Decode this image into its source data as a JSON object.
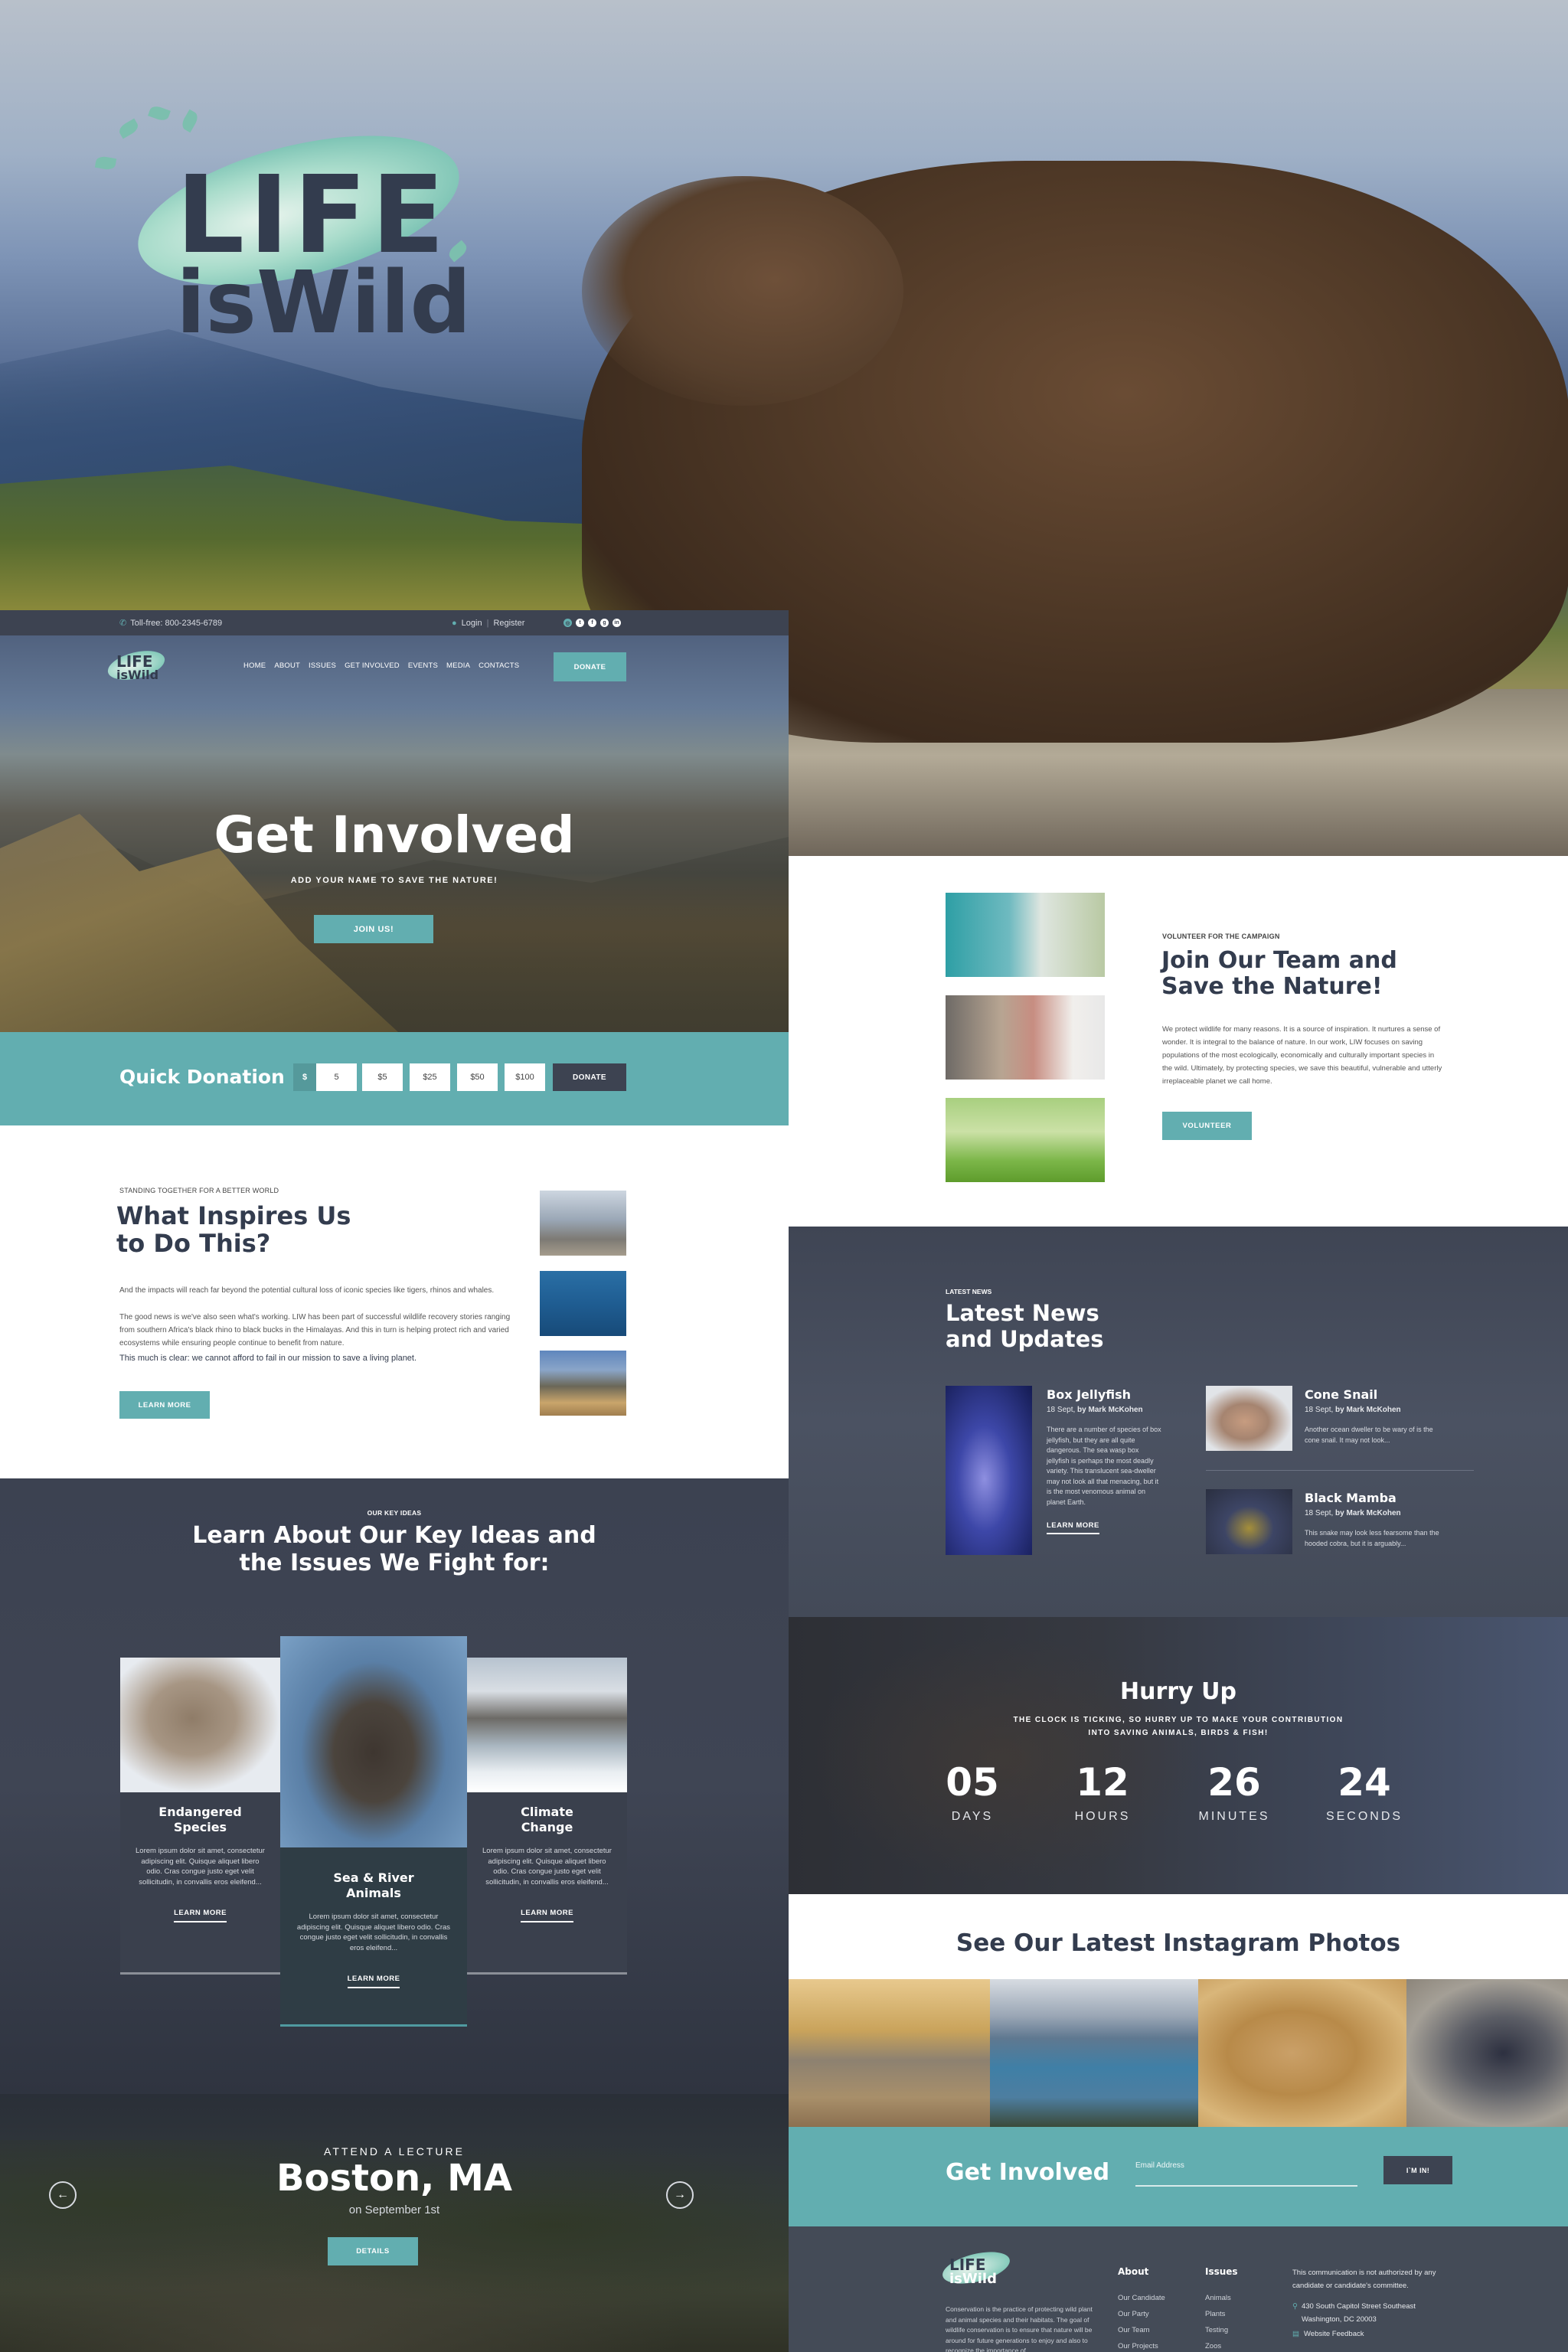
{
  "brand": {
    "line1": "LIFE",
    "line2": "isWild"
  },
  "colors": {
    "accent": "#62aeb0",
    "dark": "#3d4351",
    "heading": "#333c4e"
  },
  "topbar": {
    "phone_icon": "phone-icon",
    "phone": "Toll-free: 800-2345-6789",
    "user_icon": "user-icon",
    "login": "Login",
    "separator": "|",
    "register": "Register",
    "social": [
      {
        "icon": "instagram-icon",
        "glyph": "◎"
      },
      {
        "icon": "twitter-icon",
        "glyph": "t"
      },
      {
        "icon": "facebook-icon",
        "glyph": "f"
      },
      {
        "icon": "google-plus-icon",
        "glyph": "g"
      },
      {
        "icon": "linkedin-icon",
        "glyph": "in"
      }
    ]
  },
  "nav": {
    "items": [
      "HOME",
      "ABOUT",
      "ISSUES",
      "GET INVOLVED",
      "EVENTS",
      "MEDIA",
      "CONTACTS"
    ],
    "donate": "DONATE"
  },
  "hero": {
    "title": "Get Involved",
    "subtitle": "ADD YOUR NAME TO SAVE THE NATURE!",
    "button": "JOIN US!"
  },
  "quick_donation": {
    "label": "Quick Donation",
    "currency": "$",
    "amount_value": "5",
    "presets": [
      "$5",
      "$25",
      "$50",
      "$100"
    ],
    "button": "DONATE"
  },
  "inspire": {
    "kicker": "STANDING TOGETHER FOR A BETTER WORLD",
    "title_line1": "What Inspires Us",
    "title_line2": "to Do This?",
    "p1": "And the impacts will reach far beyond the potential cultural loss of iconic species like tigers, rhinos and whales.",
    "p2": "The good news is we've also seen what's working. LIW has been part of successful wildlife recovery stories ranging from southern Africa's black rhino to black bucks in the Himalayas. And this in turn is helping protect rich and varied ecosystems while ensuring people continue to benefit from nature.",
    "p3": "This much is clear: we cannot afford to fail in our mission to save a living planet.",
    "button": "LEARN MORE",
    "images": [
      "hiker-on-peak-photo",
      "whale-shark-diver-photo",
      "desert-canyon-photo"
    ]
  },
  "ideas": {
    "kicker": "OUR KEY IDEAS",
    "title_line1": "Learn About Our Key Ideas  and",
    "title_line2": "the Issues We Fight for:",
    "cards": [
      {
        "title_line1": "Endangered",
        "title_line2": "Species",
        "image": "wolf-photo",
        "text": "Lorem ipsum dolor sit amet, consectetur adipiscing elit. Quisque aliquet libero odio. Cras congue justo eget velit sollicitudin, in convallis eros eleifend...",
        "link": "LEARN MORE"
      },
      {
        "title_line1": "Sea & River",
        "title_line2": "Animals",
        "image": "sea-lion-photo",
        "text": "Lorem ipsum dolor sit amet, consectetur adipiscing elit. Quisque aliquet libero odio. Cras congue justo eget velit sollicitudin, in convallis eros eleifend...",
        "link": "LEARN MORE"
      },
      {
        "title_line1": "Climate",
        "title_line2": "Change",
        "image": "glacier-lake-photo",
        "text": "Lorem ipsum dolor sit amet, consectetur adipiscing elit. Quisque aliquet libero odio. Cras congue justo eget velit sollicitudin, in convallis eros eleifend...",
        "link": "LEARN MORE"
      }
    ]
  },
  "lecture": {
    "kicker": "ATTEND A LECTURE",
    "city": "Boston, MA",
    "date": "on September 1st",
    "button": "DETAILS",
    "prev": "←",
    "next": "→"
  },
  "volunteer": {
    "kicker": "VOLUNTEER FOR THE CAMPAIGN",
    "title_line1": "Join Our Team and",
    "title_line2": "Save the Nature!",
    "text": "We protect wildlife for many reasons. It is a source of inspiration. It nurtures a sense of wonder. It is integral to the balance of nature. In our work, LIW focuses on saving populations of the most ecologically, economically and culturally important species in the wild. Ultimately, by protecting species, we save this beautiful, vulnerable and utterly irreplaceable planet we call home.",
    "button": "VOLUNTEER",
    "photos": [
      "woman-with-tablet-photo",
      "couple-with-laptop-photo",
      "woman-on-grass-photo"
    ]
  },
  "news": {
    "kicker": "LATEST NEWS",
    "title_line1": "Latest News",
    "title_line2": "and Updates",
    "items": [
      {
        "title": "Box Jellyfish",
        "date": "18 Sept,",
        "author": "by Mark McKohen",
        "text": "There are a number of species of box jellyfish, but they are all quite dangerous. The sea wasp box jellyfish is perhaps the most deadly variety. This translucent sea-dweller may not look all that menacing, but it is the most venomous animal on planet Earth.",
        "link": "LEARN MORE",
        "image": "jellyfish-photo"
      },
      {
        "title": "Cone Snail",
        "date": "18 Sept,",
        "author": "by Mark McKohen",
        "text": "Another ocean dweller to be wary of is the cone snail. It may not look...",
        "image": "cone-snail-photo"
      },
      {
        "title": "Black Mamba",
        "date": "18 Sept,",
        "author": "by Mark McKohen",
        "text": "This snake may look less fearsome than the hooded cobra, but it is arguably...",
        "image": "snake-photo"
      }
    ]
  },
  "countdown": {
    "title": "Hurry Up",
    "subtitle_line1": "THE CLOCK IS TICKING, SO HURRY UP TO MAKE YOUR CONTRIBUTION",
    "subtitle_line2": "INTO SAVING ANIMALS, BIRDS & FISH!",
    "units": [
      {
        "value": "05",
        "label": "DAYS"
      },
      {
        "value": "12",
        "label": "HOURS"
      },
      {
        "value": "26",
        "label": "MINUTES"
      },
      {
        "value": "24",
        "label": "SECONDS"
      }
    ]
  },
  "instagram": {
    "title": "See Our Latest Instagram Photos",
    "photos": [
      "savanna-elephant-zebras-photo",
      "mountain-lake-hiker-photo",
      "lioness-photo",
      "fire-salamander-photo"
    ]
  },
  "signup": {
    "label": "Get Involved",
    "email_placeholder": "Email Address",
    "email_value": "",
    "button": "I`M IN!"
  },
  "footer": {
    "about_text": "Conservation is the practice of protecting wild plant and animal species and their habitats. The goal of wildlife conservation is to ensure that nature will be around for future generations to enjoy and also to recognize the importance of",
    "columns": [
      {
        "title": "About",
        "links": [
          "Our Candidate",
          "Our Party",
          "Our Team",
          "Our Projects"
        ]
      },
      {
        "title": "Issues",
        "links": [
          "Animals",
          "Plants",
          "Testing",
          "Zoos"
        ]
      }
    ],
    "notice": "This communication is not authorized by any candidate or candidate's committee.",
    "address_line1": "430 South Capitol Street Southeast",
    "address_line2": "Washington, DC 20003",
    "feedback": "Website Feedback"
  }
}
